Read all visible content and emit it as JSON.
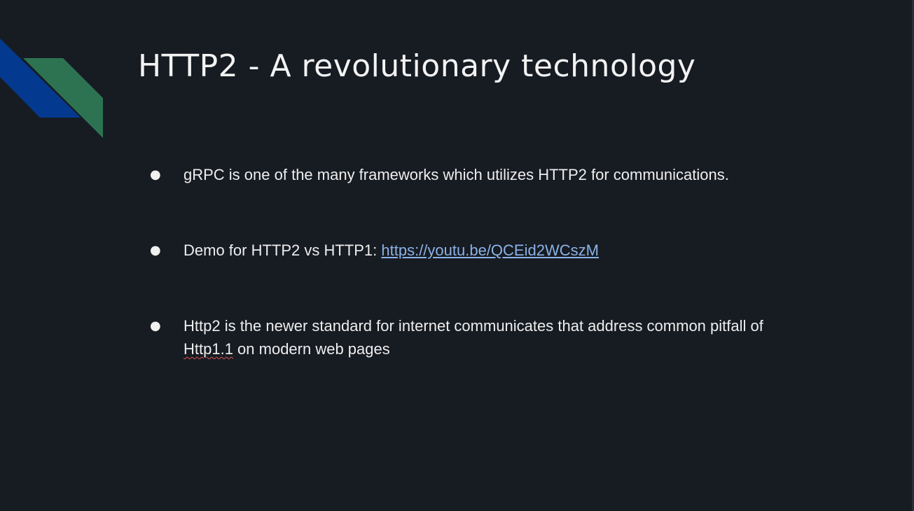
{
  "slide": {
    "title": "HTTP2 - A revolutionary technology",
    "colors": {
      "background": "#171b22",
      "text": "#f2f2f2",
      "link": "#8ab2e5",
      "deco_blue": "#033a8f",
      "deco_green": "#2d7352"
    },
    "bullets": [
      {
        "symbol": "●",
        "text": "gRPC is one of the many frameworks which utilizes HTTP2 for communications."
      },
      {
        "symbol": "●",
        "prefix": "Demo for HTTP2 vs HTTP1: ",
        "link_text": "https://youtu.be/QCEid2WCszM"
      },
      {
        "symbol": "●",
        "flagged_word": "Http1.1",
        "text_before_flag": "Http2 is the newer standard for internet communicates that address common pitfall of ",
        "text_after_flag": " on modern web pages"
      }
    ]
  }
}
